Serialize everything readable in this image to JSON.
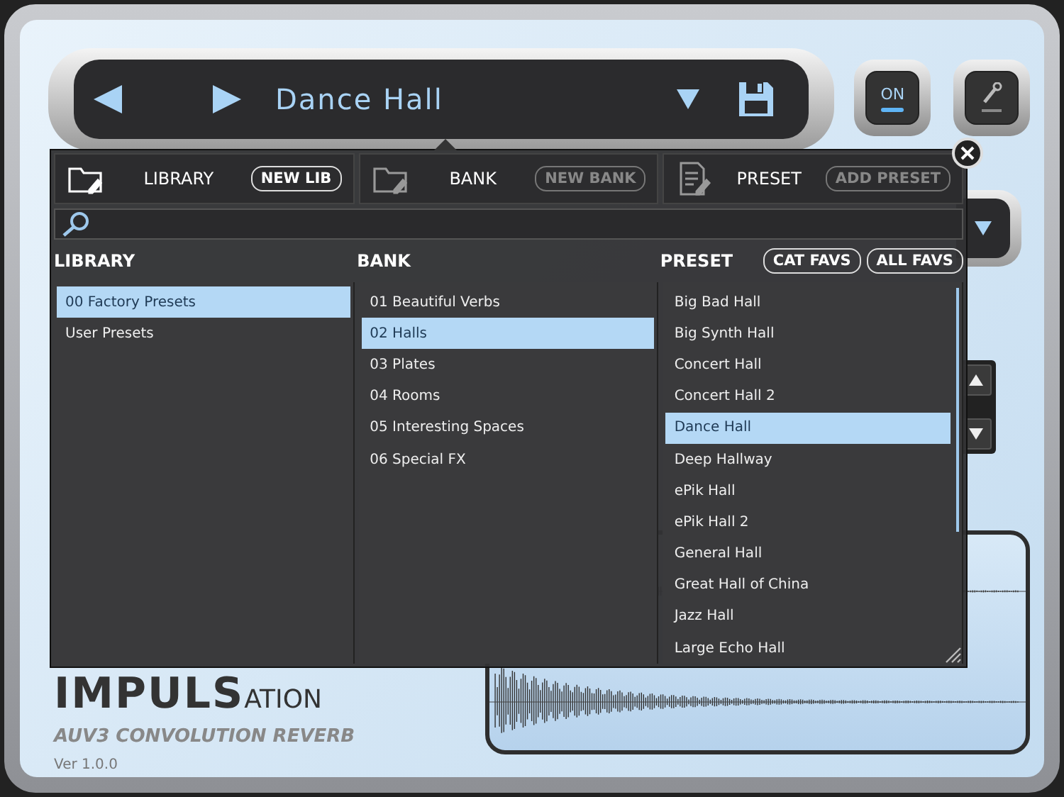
{
  "preset_bar": {
    "name": "Dance Hall"
  },
  "power_button": {
    "label": "ON",
    "on": true
  },
  "popup": {
    "sections": [
      {
        "title": "LIBRARY",
        "button": "NEW LIB",
        "enabled": true
      },
      {
        "title": "BANK",
        "button": "NEW BANK",
        "enabled": false
      },
      {
        "title": "PRESET",
        "button": "ADD PRESET",
        "enabled": false
      }
    ],
    "filter_buttons": [
      "CAT FAVS",
      "ALL FAVS"
    ],
    "columns": [
      {
        "heading": "LIBRARY",
        "items": [
          {
            "label": "00 Factory Presets",
            "selected": true
          },
          {
            "label": "User Presets",
            "selected": false
          }
        ]
      },
      {
        "heading": "BANK",
        "items": [
          {
            "label": "01 Beautiful Verbs",
            "selected": false
          },
          {
            "label": "02 Halls",
            "selected": true
          },
          {
            "label": "03 Plates",
            "selected": false
          },
          {
            "label": "04 Rooms",
            "selected": false
          },
          {
            "label": "05 Interesting Spaces",
            "selected": false
          },
          {
            "label": "06 Special FX",
            "selected": false
          }
        ]
      },
      {
        "heading": "PRESET",
        "items": [
          {
            "label": "Big Bad Hall",
            "selected": false
          },
          {
            "label": "Big Synth Hall",
            "selected": false
          },
          {
            "label": "Concert Hall",
            "selected": false
          },
          {
            "label": "Concert Hall 2",
            "selected": false
          },
          {
            "label": "Dance Hall",
            "selected": true
          },
          {
            "label": "Deep Hallway",
            "selected": false
          },
          {
            "label": "ePik Hall",
            "selected": false
          },
          {
            "label": "ePik Hall 2",
            "selected": false
          },
          {
            "label": "General Hall",
            "selected": false
          },
          {
            "label": "Great Hall of China",
            "selected": false
          },
          {
            "label": "Jazz Hall",
            "selected": false
          },
          {
            "label": "Large Echo Hall",
            "selected": false
          }
        ]
      }
    ]
  },
  "logo": {
    "bold": "IMPULS",
    "light": "ATION"
  },
  "subtitle": "AUV3 CONVOLUTION REVERB",
  "version": "Ver 1.0.0"
}
